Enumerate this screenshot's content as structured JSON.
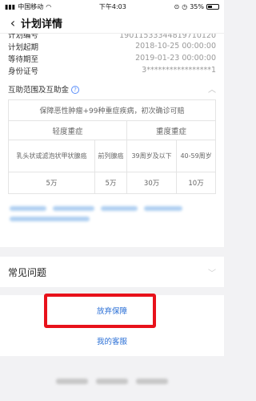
{
  "status_bar": {
    "carrier": "中国移动",
    "time": "下午4:03",
    "battery": "35%"
  },
  "nav": {
    "title": "计划详情"
  },
  "details": [
    {
      "label": "计划编号",
      "value": "19011533344819710120"
    },
    {
      "label": "计划起期",
      "value": "2018-10-25 00:00:00"
    },
    {
      "label": "等待期至",
      "value": "2019-01-23 00:00:00"
    },
    {
      "label": "身份证号",
      "value": "3*****************1"
    }
  ],
  "section": {
    "title": "互助范围及互助金",
    "help": "?"
  },
  "coverage": {
    "description": "保障恶性肿瘤+99种重症疾病，初次确诊可赔",
    "mild": "轻度重症",
    "severe": "重度重症",
    "sub": [
      "乳头状或滤泡状甲状腺癌",
      "前列腺癌",
      "39周岁及以下",
      "40-59周岁"
    ],
    "amounts": [
      "5万",
      "5万",
      "30万",
      "10万"
    ]
  },
  "faq": {
    "title": "常见问题"
  },
  "actions": {
    "abandon": "放弃保障",
    "service": "我的客服"
  },
  "colors": {
    "accent": "#2a6fd6",
    "highlight": "#e8121b"
  }
}
